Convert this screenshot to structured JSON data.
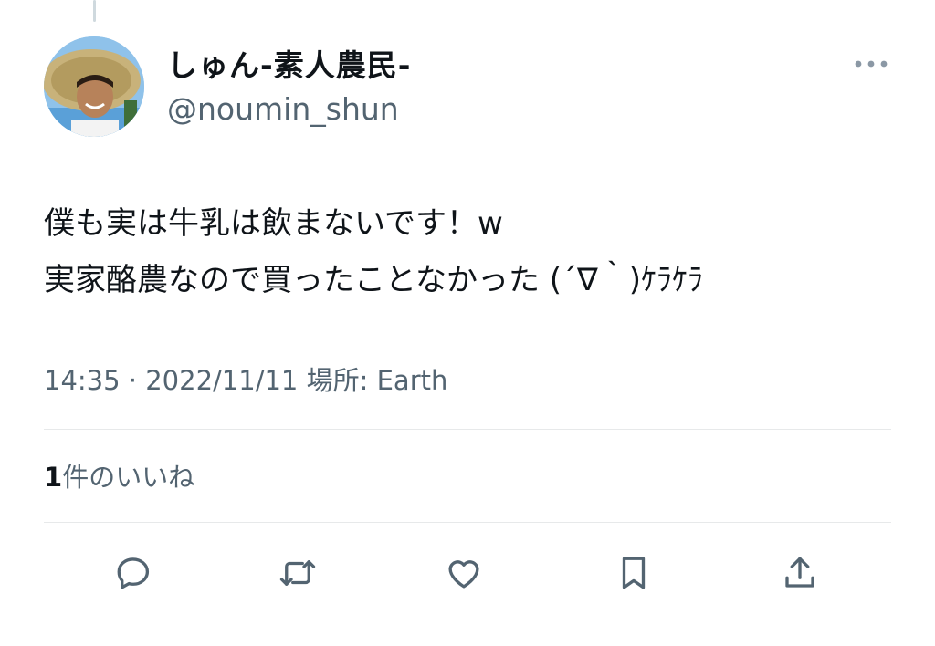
{
  "author": {
    "display_name": "しゅん-素人農民-",
    "handle": "@noumin_shun"
  },
  "tweet": {
    "text": "僕も実は牛乳は飲まないです！w\n実家酪農なので買ったことなかった (´∇｀)ｹﾗｹﾗ"
  },
  "meta": {
    "time": "14:35",
    "separator": " · ",
    "date": "2022/11/11",
    "location_label": " 場所: ",
    "location": "Earth"
  },
  "stats": {
    "like_count": "1",
    "like_label": "件のいいね"
  },
  "icons": {
    "more": "more-horizontal-icon",
    "reply": "reply-icon",
    "retweet": "retweet-icon",
    "like": "like-icon",
    "bookmark": "bookmark-icon",
    "share": "share-icon"
  },
  "colors": {
    "text": "#0f1419",
    "secondary": "#536471",
    "divider": "#e7e9ea"
  }
}
